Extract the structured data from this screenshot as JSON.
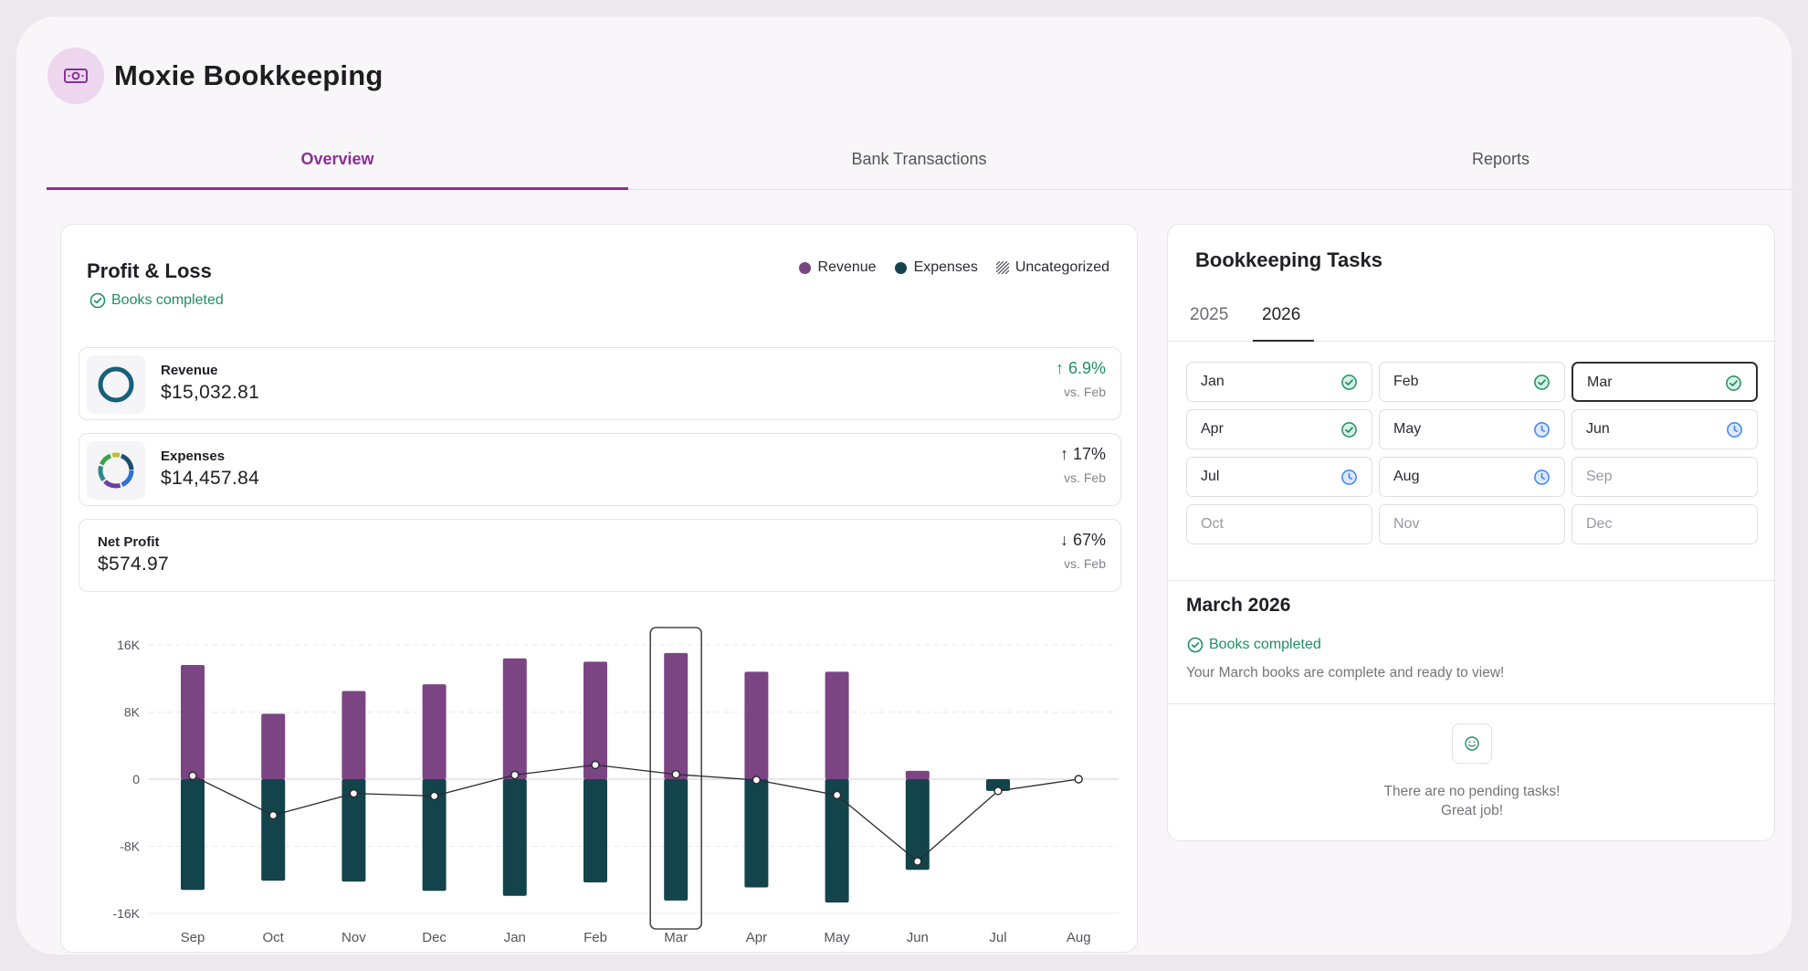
{
  "app": {
    "title": "Moxie Bookkeeping",
    "logo_icon": "cash-icon"
  },
  "tabs": [
    {
      "label": "Overview",
      "active": true
    },
    {
      "label": "Bank Transactions",
      "active": false
    },
    {
      "label": "Reports",
      "active": false
    }
  ],
  "profit_loss": {
    "title": "Profit & Loss",
    "books_status": "Books completed",
    "legend": [
      {
        "label": "Revenue",
        "color": "#7b4583"
      },
      {
        "label": "Expenses",
        "color": "#14444b"
      },
      {
        "label": "Uncategorized",
        "pattern": "hatch"
      }
    ],
    "metrics": [
      {
        "label": "Revenue",
        "value": "$15,032.81",
        "change": "6.9%",
        "direction": "up",
        "vs": "vs. Feb"
      },
      {
        "label": "Expenses",
        "value": "$14,457.84",
        "change": "17%",
        "direction": "up",
        "vs": "vs. Feb"
      },
      {
        "label": "Net Profit",
        "value": "$574.97",
        "change": "67%",
        "direction": "down",
        "vs": "vs. Feb"
      }
    ]
  },
  "chart_data": {
    "type": "bar",
    "categories": [
      "Sep",
      "Oct",
      "Nov",
      "Dec",
      "Jan",
      "Feb",
      "Mar",
      "Apr",
      "May",
      "Jun",
      "Jul",
      "Aug"
    ],
    "y_ticks": [
      "16K",
      "8K",
      "0",
      "-8K",
      "-16K"
    ],
    "ylim": [
      -16000,
      16000
    ],
    "selected_category": "Mar",
    "series": [
      {
        "name": "Revenue",
        "color": "#7b4583",
        "values": [
          13600,
          7800,
          10500,
          11300,
          14400,
          14000,
          15033,
          12800,
          12800,
          1000,
          0,
          0
        ]
      },
      {
        "name": "Expenses",
        "color": "#14444b",
        "values": [
          -13200,
          -12100,
          -12200,
          -13300,
          -13900,
          -12300,
          -14458,
          -12900,
          -14700,
          -10800,
          -1400,
          0
        ]
      }
    ],
    "net_line": [
      400,
      -4300,
      -1700,
      -2000,
      500,
      1700,
      575,
      -100,
      -1900,
      -9800,
      -1400,
      0
    ],
    "grid": true,
    "legend": "top-right"
  },
  "tasks": {
    "title": "Bookkeeping Tasks",
    "years": [
      {
        "label": "2025",
        "active": false
      },
      {
        "label": "2026",
        "active": true
      }
    ],
    "months": [
      {
        "label": "Jan",
        "status": "complete"
      },
      {
        "label": "Feb",
        "status": "complete"
      },
      {
        "label": "Mar",
        "status": "complete",
        "selected": true
      },
      {
        "label": "Apr",
        "status": "complete"
      },
      {
        "label": "May",
        "status": "pending"
      },
      {
        "label": "Jun",
        "status": "pending"
      },
      {
        "label": "Jul",
        "status": "pending"
      },
      {
        "label": "Aug",
        "status": "pending"
      },
      {
        "label": "Sep",
        "status": "future"
      },
      {
        "label": "Oct",
        "status": "future"
      },
      {
        "label": "Nov",
        "status": "future"
      },
      {
        "label": "Dec",
        "status": "future"
      }
    ],
    "month_detail": {
      "title": "March 2026",
      "status": "Books completed",
      "description": "Your March books are complete and ready to view!"
    },
    "empty_state": {
      "line1": "There are no pending tasks!",
      "line2": "Great job!",
      "icon": "smile-icon"
    }
  },
  "colors": {
    "accent": "#8a2f96",
    "success": "#1f8f62",
    "pending": "#3b82f6",
    "revenue": "#7b4583",
    "expenses": "#14444b"
  }
}
